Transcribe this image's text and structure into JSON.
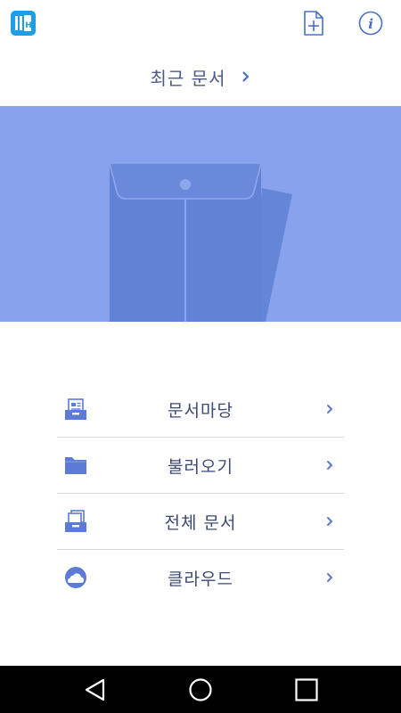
{
  "header": {
    "logo_icon": "hancom-office-app-icon",
    "new_document_icon": "new-document-icon",
    "info_icon": "info-icon"
  },
  "recent": {
    "label": "최근 문서"
  },
  "menu": {
    "items": [
      {
        "label": "문서마당",
        "icon": "template-tray-icon"
      },
      {
        "label": "불러오기",
        "icon": "folder-icon"
      },
      {
        "label": "전체 문서",
        "icon": "documents-tray-icon"
      },
      {
        "label": "클라우드",
        "icon": "cloud-icon"
      }
    ]
  },
  "colors": {
    "accent": "#5b7bd6",
    "hero_background": "#88a2ee",
    "text": "#3c4a74",
    "divider": "#d6d6d6"
  },
  "navigation": {
    "back_icon": "back-triangle-icon",
    "home_icon": "home-circle-icon",
    "recents_icon": "recents-square-icon"
  }
}
